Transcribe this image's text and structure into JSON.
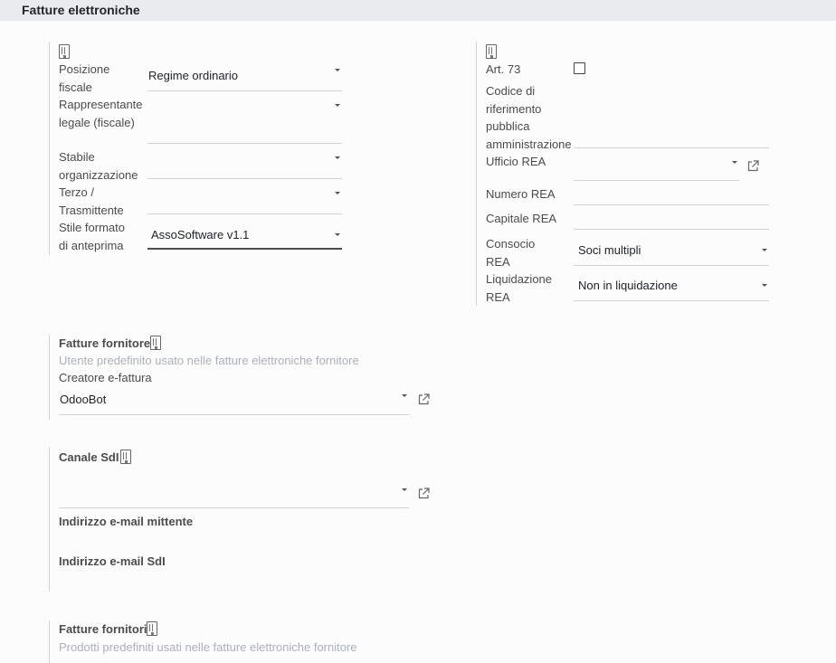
{
  "header": {
    "title": "Fatture elettroniche"
  },
  "left_panel": {
    "building_icon": "building-icon",
    "fields": [
      {
        "label": "Posizione fiscale",
        "value": "Regime ordinario"
      },
      {
        "label": "Rappresentante legale (fiscale)",
        "value": ""
      },
      {
        "label": "Stabile organizzazione",
        "value": ""
      },
      {
        "label": "Terzo / Trasmittente",
        "value": ""
      },
      {
        "label": "Stile formato di anteprima",
        "value": "AssoSoftware v1.1"
      }
    ]
  },
  "right_panel": {
    "building_icon": "building-icon",
    "art73_label": "Art. 73",
    "art73_checked": false,
    "codice_label": "Codice di riferimento pubblica amministrazione",
    "codice_value": "",
    "ufficio_rea_label": "Ufficio REA",
    "ufficio_rea_value": "",
    "numero_rea_label": "Numero REA",
    "numero_rea_value": "",
    "capitale_rea_label": "Capitale REA",
    "capitale_rea_value": "",
    "consocio_label": "Consocio REA",
    "consocio_value": "Soci multipli",
    "liquidazione_label": "Liquidazione REA",
    "liquidazione_value": "Non in liquidazione"
  },
  "supplier_invoices": {
    "title": "Fatture fornitore",
    "help": "Utente predefinito usato nelle fatture elettroniche fornitore",
    "creator_label": "Creatore e-fattura",
    "creator_value": "OdooBot"
  },
  "sdi_channel": {
    "title": "Canale SdI",
    "channel_value": "",
    "sender_email_label": "Indirizzo e-mail mittente",
    "sdi_email_label": "Indirizzo e-mail SdI"
  },
  "supplier_products": {
    "title": "Fatture fornitori",
    "help": "Prodotti predefiniti usati nelle fatture elettroniche fornitore"
  }
}
